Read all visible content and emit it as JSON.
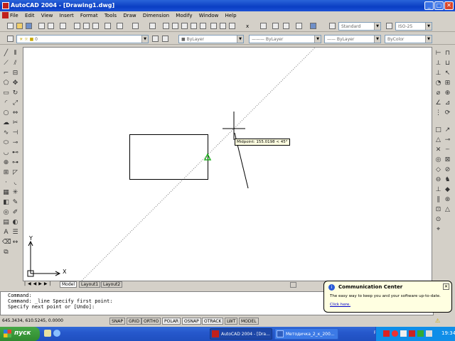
{
  "window": {
    "title": "AutoCAD 2004 - [Drawing1.dwg]"
  },
  "menu": [
    "File",
    "Edit",
    "View",
    "Insert",
    "Format",
    "Tools",
    "Draw",
    "Dimension",
    "Modify",
    "Window",
    "Help"
  ],
  "toolbar": {
    "text_style": "Standard",
    "dim_style": "ISO-25",
    "layer": "0",
    "color": "ByLayer",
    "linetype": "ByLayer",
    "lineweight": "ByLayer",
    "plot_style": "ByColor",
    "undo_label": "x"
  },
  "canvas": {
    "tooltip": "Midpoint: 155.0198 < 45°",
    "ucs_x": "X",
    "ucs_y": "Y"
  },
  "layout_tabs": [
    "Model",
    "Layout1",
    "Layout2"
  ],
  "command": {
    "line1": "Command:",
    "line2": "Command: _line Specify first point:",
    "line3": "Specify next point or [Undo]:"
  },
  "status": {
    "coords": "645.3434, 610.5245, 0.0000",
    "buttons": [
      "SNAP",
      "GRID",
      "ORTHO",
      "POLAR",
      "OSNAP",
      "OTRACK",
      "LWT",
      "MODEL"
    ]
  },
  "balloon": {
    "title": "Communication Center",
    "message": "The easy way to keep you and your software up-to-date.",
    "link": "Click here."
  },
  "taskbar": {
    "start": "пуск",
    "items": [
      "AutoCAD 2004 - [Dra...",
      "Методичка_2_к_200..."
    ],
    "lang": "RU",
    "clock": "19:34"
  }
}
